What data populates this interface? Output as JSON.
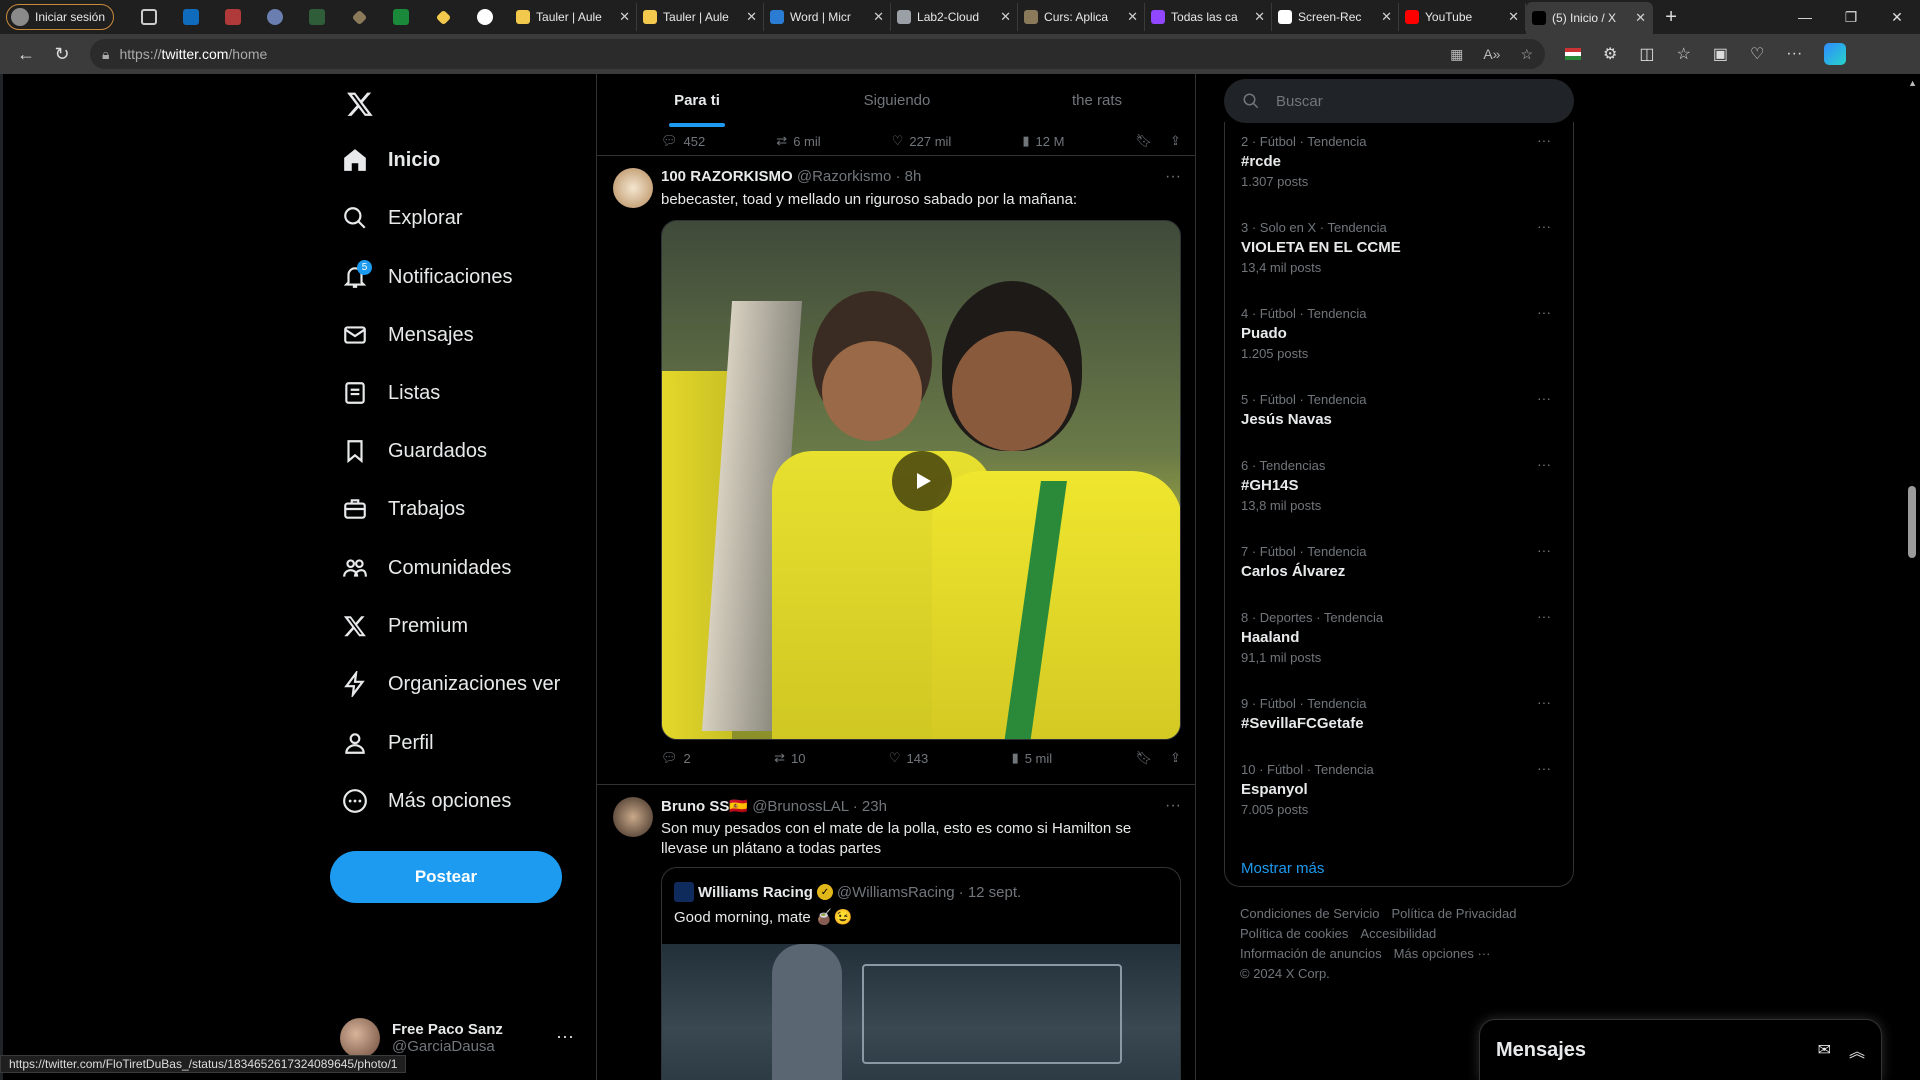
{
  "browser": {
    "profile_label": "Iniciar sesión",
    "tabs": [
      {
        "label": "Tauler | Aule",
        "color": "#f2c94c"
      },
      {
        "label": "Tauler | Aule",
        "color": "#f2c94c"
      },
      {
        "label": "Word | Micr",
        "color": "#2b7cd3"
      },
      {
        "label": "Lab2-Cloud",
        "color": "#9aa0a6"
      },
      {
        "label": "Curs: Aplica",
        "color": "#8a7a5a"
      },
      {
        "label": "Todas las ca",
        "color": "#9146ff"
      },
      {
        "label": "Screen-Rec",
        "color": "#ffffff"
      },
      {
        "label": "YouTube",
        "color": "#ff0000"
      },
      {
        "label": "(5) Inicio / X",
        "color": "#000000"
      }
    ],
    "url_scheme": "https://",
    "url_host": "twitter.com",
    "url_path": "/home",
    "status_url": "https://twitter.com/FloTiretDuBas_/status/1834652617324089645/photo/1"
  },
  "sidebar": {
    "items": [
      {
        "label": "Inicio",
        "icon": "home-icon"
      },
      {
        "label": "Explorar",
        "icon": "search-icon"
      },
      {
        "label": "Notificaciones",
        "icon": "bell-icon",
        "badge": "5"
      },
      {
        "label": "Mensajes",
        "icon": "envelope-icon"
      },
      {
        "label": "Listas",
        "icon": "list-icon"
      },
      {
        "label": "Guardados",
        "icon": "bookmark-icon"
      },
      {
        "label": "Trabajos",
        "icon": "briefcase-icon"
      },
      {
        "label": "Comunidades",
        "icon": "people-icon"
      },
      {
        "label": "Premium",
        "icon": "x-logo-icon"
      },
      {
        "label": "Organizaciones ver",
        "icon": "lightning-icon"
      },
      {
        "label": "Perfil",
        "icon": "person-icon"
      },
      {
        "label": "Más opciones",
        "icon": "more-circle-icon"
      }
    ],
    "post_button": "Postear",
    "account": {
      "display_name": "Free Paco Sanz",
      "handle": "@GarciaDausa"
    }
  },
  "timeline": {
    "tabs": [
      "Para ti",
      "Siguiendo",
      "the rats"
    ],
    "prev_stats": {
      "replies": "452",
      "reposts": "6 mil",
      "likes": "227 mil",
      "views": "12 M"
    },
    "tweet1": {
      "name": "100 RAZORKISMO",
      "handle": "@Razorkismo",
      "time": "· 8h",
      "text": "bebecaster, toad y mellado un riguroso sabado por la mañana:",
      "stats": {
        "replies": "2",
        "reposts": "10",
        "likes": "143",
        "views": "5 mil"
      }
    },
    "tweet2": {
      "name": "Bruno SS🇪🇸",
      "handle": "@BrunossLAL",
      "time": "· 23h",
      "text": "Son muy pesados con el mate de la polla, esto es como si Hamilton se llevase un plátano a todas partes",
      "quote": {
        "name": "Williams Racing",
        "handle": "@WilliamsRacing",
        "time": "· 12 sept.",
        "text": "Good morning, mate 🧉😉"
      }
    }
  },
  "right": {
    "search_placeholder": "Buscar",
    "trends": [
      {
        "meta": "2 · Fútbol · Tendencia",
        "name": "#rcde",
        "count": "1.307 posts"
      },
      {
        "meta": "3 · Solo en X · Tendencia",
        "name": "VIOLETA EN EL CCME",
        "count": "13,4 mil posts"
      },
      {
        "meta": "4 · Fútbol · Tendencia",
        "name": "Puado",
        "count": "1.205 posts"
      },
      {
        "meta": "5 · Fútbol · Tendencia",
        "name": "Jesús Navas",
        "count": ""
      },
      {
        "meta": "6 · Tendencias",
        "name": "#GH14S",
        "count": "13,8 mil posts"
      },
      {
        "meta": "7 · Fútbol · Tendencia",
        "name": "Carlos Álvarez",
        "count": ""
      },
      {
        "meta": "8 · Deportes · Tendencia",
        "name": "Haaland",
        "count": "91,1 mil posts"
      },
      {
        "meta": "9 · Fútbol · Tendencia",
        "name": "#SevillaFCGetafe",
        "count": ""
      },
      {
        "meta": "10 · Fútbol · Tendencia",
        "name": "Espanyol",
        "count": "7.005 posts"
      }
    ],
    "show_more": "Mostrar más",
    "footer": {
      "terms": "Condiciones de Servicio",
      "privacy": "Política de Privacidad",
      "cookies": "Política de cookies",
      "accessibility": "Accesibilidad",
      "ads": "Información de anuncios",
      "more": "Más opciones ···",
      "copyright": "© 2024 X Corp."
    },
    "messages_drawer": "Mensajes"
  }
}
